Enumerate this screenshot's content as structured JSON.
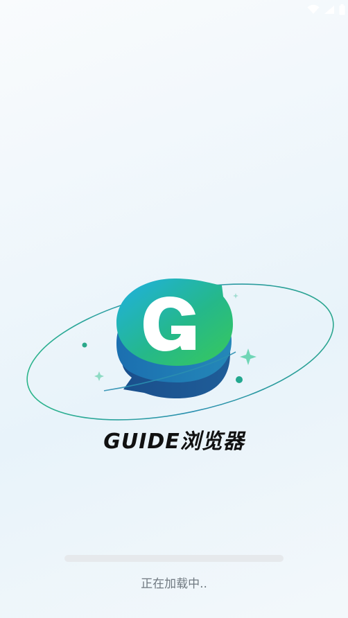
{
  "app": {
    "brand_name": "GUIDE浏览器",
    "logo_letter": "G"
  },
  "loading": {
    "status_text": "正在加载中..",
    "progress_fraction": 0
  },
  "icons": {
    "wifi": "wifi-icon",
    "signal": "signal-icon",
    "battery": "battery-icon"
  },
  "colors": {
    "brand_green": "#2fc46a",
    "brand_teal": "#1da1c9",
    "brand_blue": "#1f5f9e",
    "orbit": "#2a9e9a"
  }
}
